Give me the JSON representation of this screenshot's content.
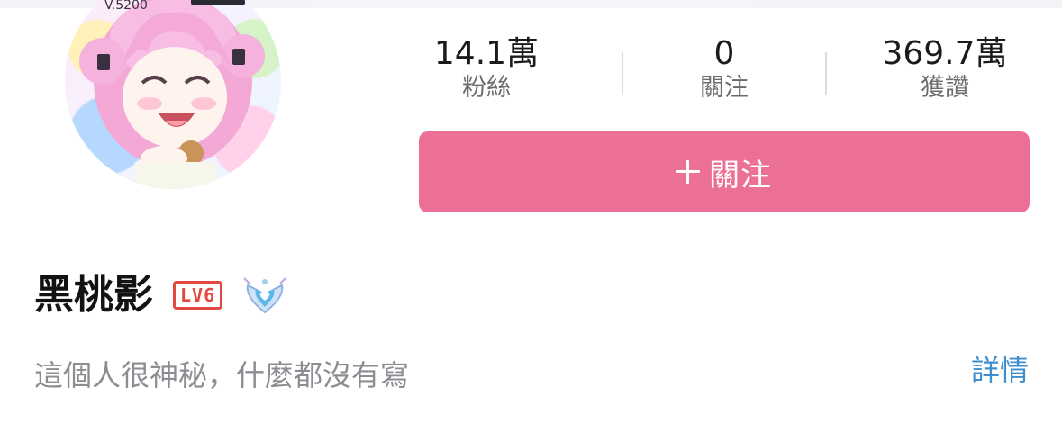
{
  "stats": [
    {
      "value": "14.1萬",
      "label": "粉絲"
    },
    {
      "value": "0",
      "label": "關注"
    },
    {
      "value": "369.7萬",
      "label": "獲讚"
    }
  ],
  "follow_button": {
    "label": "關注",
    "icon": "plus-icon"
  },
  "profile": {
    "username": "黑桃影",
    "level_badge": "LV6",
    "medal_icon": "wing-heart-medal-icon",
    "bio": "這個人很神秘，什麼都沒有寫",
    "details_link": "詳情",
    "avatar_overlay_text": "V.5200"
  },
  "colors": {
    "accent_pink": "#ec7095",
    "level_red": "#e2483d",
    "link_blue": "#3f8fce",
    "bio_gray": "#8c8c92"
  }
}
